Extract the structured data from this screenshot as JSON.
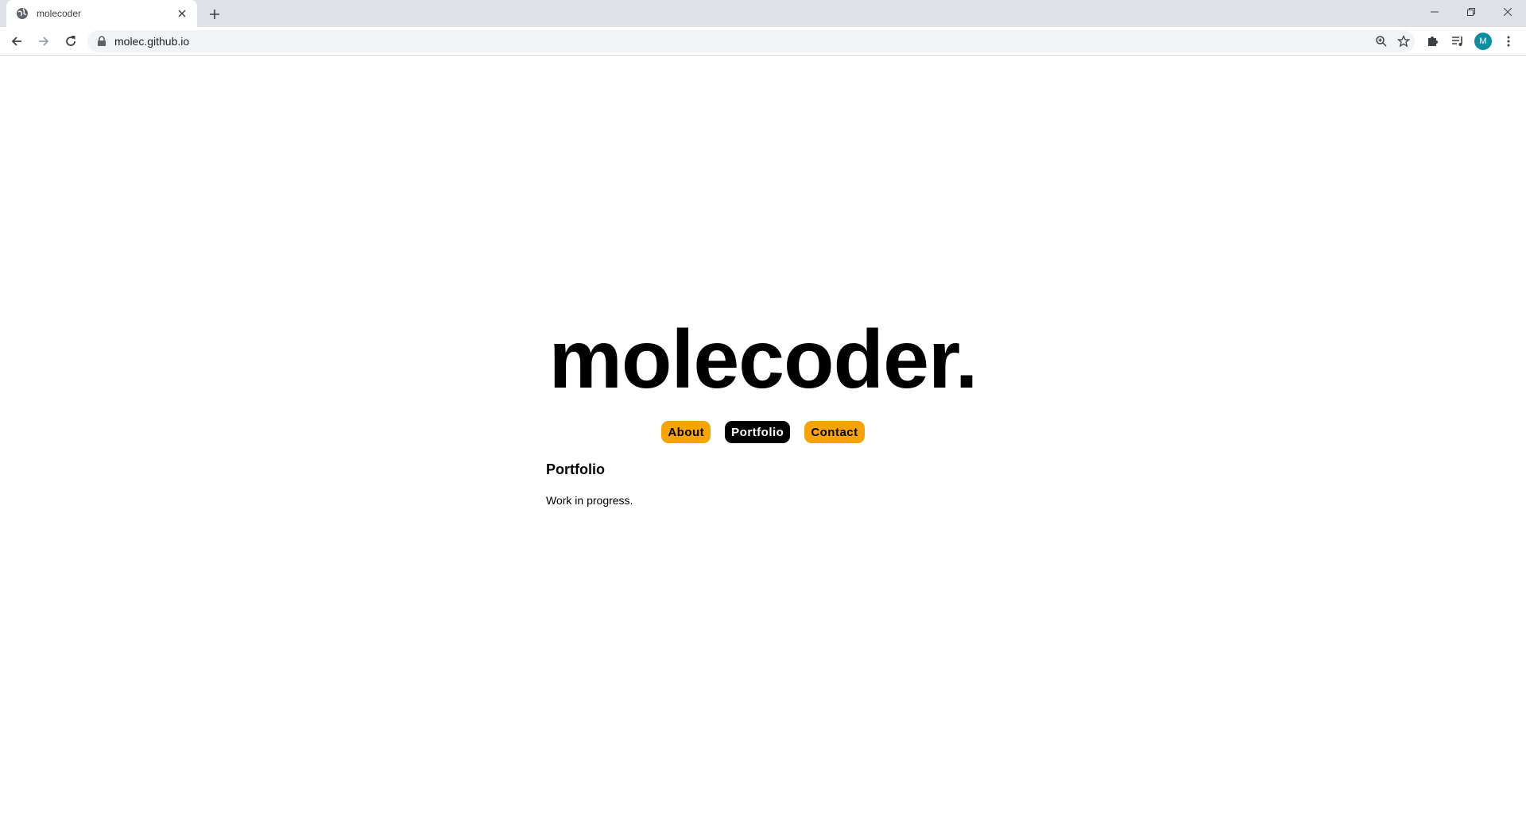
{
  "browser": {
    "tab": {
      "title": "molecoder",
      "favicon": "globe-icon"
    },
    "url": "molec.github.io",
    "profile_initial": "M",
    "accent_color": "#0c8ea0"
  },
  "page": {
    "site_title": "molecoder.",
    "nav": [
      {
        "label": "About",
        "active": false
      },
      {
        "label": "Portfolio",
        "active": true
      },
      {
        "label": "Contact",
        "active": false
      }
    ],
    "section": {
      "heading": "Portfolio",
      "text": "Work in progress."
    },
    "colors": {
      "nav_pill": "#f7a300",
      "nav_active": "#000000",
      "background": "#ffffff"
    }
  }
}
